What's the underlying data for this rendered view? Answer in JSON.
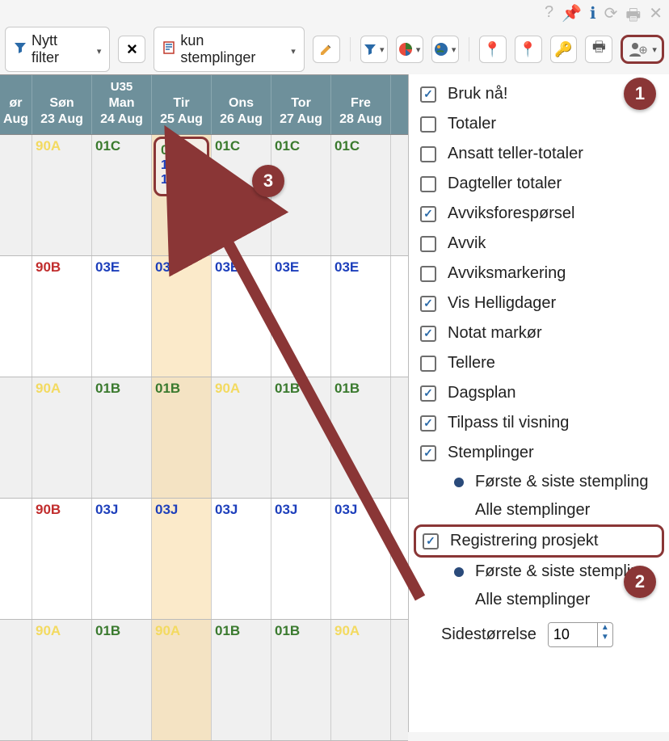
{
  "topIcons": {
    "help": "?",
    "pin": "📌",
    "info": "i",
    "refresh": "⟳",
    "print": "🖶",
    "close": "✕"
  },
  "toolbar": {
    "filter_label": "Nytt filter",
    "filter_clear": "×",
    "stamp_label": "kun stemplinger"
  },
  "calendar": {
    "headers": [
      {
        "top": "",
        "mid": "ør",
        "bot": "Aug"
      },
      {
        "top": "",
        "mid": "Søn",
        "bot": "23 Aug"
      },
      {
        "top": "U35",
        "mid": "Man",
        "bot": "24 Aug"
      },
      {
        "top": "",
        "mid": "Tir",
        "bot": "25 Aug"
      },
      {
        "top": "",
        "mid": "Ons",
        "bot": "26 Aug"
      },
      {
        "top": "",
        "mid": "Tor",
        "bot": "27 Aug"
      },
      {
        "top": "",
        "mid": "Fre",
        "bot": "28 Aug"
      }
    ],
    "rows": [
      {
        "alt": true,
        "cells": [
          {
            "text": "",
            "cls": ""
          },
          {
            "text": "90A",
            "cls": "code-yellow"
          },
          {
            "text": "01C",
            "cls": "code-green"
          },
          {
            "text": "01C",
            "cls": "code-green",
            "stamps": [
              "10:10",
              "10:12"
            ]
          },
          {
            "text": "01C",
            "cls": "code-green"
          },
          {
            "text": "01C",
            "cls": "code-green"
          },
          {
            "text": "01C",
            "cls": "code-green"
          }
        ]
      },
      {
        "alt": false,
        "cells": [
          {
            "text": "",
            "cls": "code-red"
          },
          {
            "text": "90B",
            "cls": "code-red"
          },
          {
            "text": "03E",
            "cls": "code-blue"
          },
          {
            "text": "03E",
            "cls": "code-blue"
          },
          {
            "text": "03E",
            "cls": "code-blue"
          },
          {
            "text": "03E",
            "cls": "code-blue"
          },
          {
            "text": "03E",
            "cls": "code-blue"
          }
        ]
      },
      {
        "alt": true,
        "cells": [
          {
            "text": "",
            "cls": ""
          },
          {
            "text": "90A",
            "cls": "code-yellow"
          },
          {
            "text": "01B",
            "cls": "code-green"
          },
          {
            "text": "01B",
            "cls": "code-green"
          },
          {
            "text": "90A",
            "cls": "code-yellow"
          },
          {
            "text": "01B",
            "cls": "code-green"
          },
          {
            "text": "01B",
            "cls": "code-green"
          }
        ]
      },
      {
        "alt": false,
        "cells": [
          {
            "text": "",
            "cls": "code-red"
          },
          {
            "text": "90B",
            "cls": "code-red"
          },
          {
            "text": "03J",
            "cls": "code-blue"
          },
          {
            "text": "03J",
            "cls": "code-blue"
          },
          {
            "text": "03J",
            "cls": "code-blue"
          },
          {
            "text": "03J",
            "cls": "code-blue"
          },
          {
            "text": "03J",
            "cls": "code-blue"
          }
        ]
      },
      {
        "alt": true,
        "cells": [
          {
            "text": "",
            "cls": ""
          },
          {
            "text": "90A",
            "cls": "code-yellow"
          },
          {
            "text": "01B",
            "cls": "code-green"
          },
          {
            "text": "90A",
            "cls": "code-yellow"
          },
          {
            "text": "01B",
            "cls": "code-green"
          },
          {
            "text": "01B",
            "cls": "code-green"
          },
          {
            "text": "90A",
            "cls": "code-yellow"
          }
        ]
      }
    ]
  },
  "panel": {
    "opts": [
      {
        "label": "Bruk nå!",
        "checked": true
      },
      {
        "label": "Totaler",
        "checked": false
      },
      {
        "label": "Ansatt teller-totaler",
        "checked": false
      },
      {
        "label": "Dagteller totaler",
        "checked": false
      },
      {
        "label": "Avviksforespørsel",
        "checked": true
      },
      {
        "label": "Avvik",
        "checked": false
      },
      {
        "label": "Avviksmarkering",
        "checked": false
      },
      {
        "label": "Vis Helligdager",
        "checked": true
      },
      {
        "label": "Notat markør",
        "checked": true
      },
      {
        "label": "Tellere",
        "checked": false
      },
      {
        "label": "Dagsplan",
        "checked": true
      },
      {
        "label": "Tilpass til visning",
        "checked": true
      },
      {
        "label": "Stemplinger",
        "checked": true
      }
    ],
    "sub1a": "Første & siste stempling",
    "sub1b": "Alle stemplinger",
    "opt_reg": {
      "label": "Registrering prosjekt",
      "checked": true
    },
    "sub2a": "Første & siste stempling",
    "sub2b": "Alle stemplinger",
    "pagesize_label": "Sidestørrelse",
    "pagesize_value": "10"
  },
  "badges": {
    "b1": "1",
    "b2": "2",
    "b3": "3"
  }
}
